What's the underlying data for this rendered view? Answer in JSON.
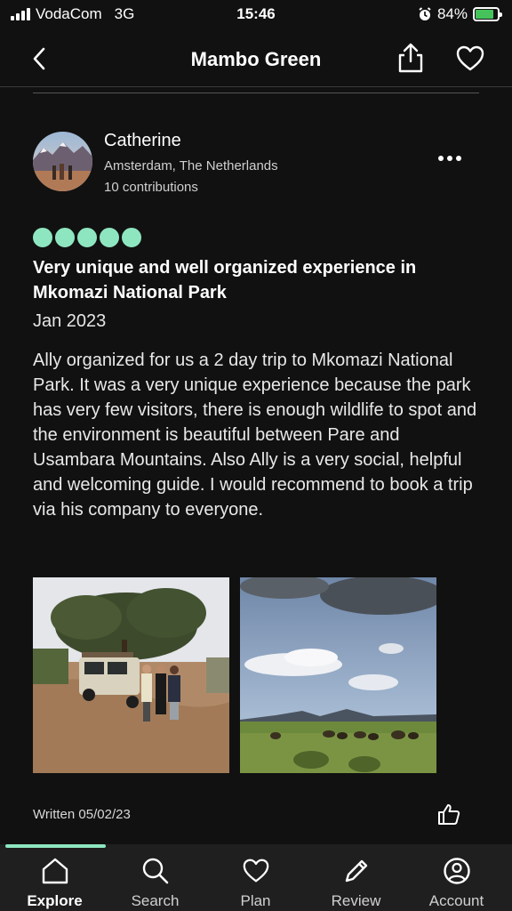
{
  "status_bar": {
    "carrier": "VodaCom",
    "network": "3G",
    "time": "15:46",
    "battery": "84%",
    "battery_level": 0.84,
    "icons": [
      "signal-icon",
      "alarm-icon",
      "battery-charging-icon"
    ]
  },
  "header": {
    "title": "Mambo Green",
    "icons": [
      "back-icon",
      "share-icon",
      "heart-icon"
    ]
  },
  "review": {
    "reviewer_name": "Catherine",
    "reviewer_location": "Amsterdam, The Netherlands",
    "reviewer_contributions": "10 contributions",
    "rating": 5,
    "rating_max": 5,
    "rating_color": "#8ee6c0",
    "title": "Very unique and well organized experience in Mkomazi National Park",
    "date": "Jan 2023",
    "body": "Ally organized for us a 2 day trip to Mkomazi National Park. It was a very unique experience because the park has very few visitors, there is enough wildlife to spot and the environment is beautiful between Pare and Usambara Mountains. Also Ally is a very social, helpful and welcoming guide. I would recommend to book a trip via his company to everyone.",
    "written": "Written 05/02/23"
  },
  "bottom_nav": {
    "items": [
      {
        "label": "Explore",
        "icon": "home-icon",
        "active": true
      },
      {
        "label": "Search",
        "icon": "search-icon",
        "active": false
      },
      {
        "label": "Plan",
        "icon": "heart-icon",
        "active": false
      },
      {
        "label": "Review",
        "icon": "pencil-icon",
        "active": false
      },
      {
        "label": "Account",
        "icon": "account-icon",
        "active": false
      }
    ]
  }
}
